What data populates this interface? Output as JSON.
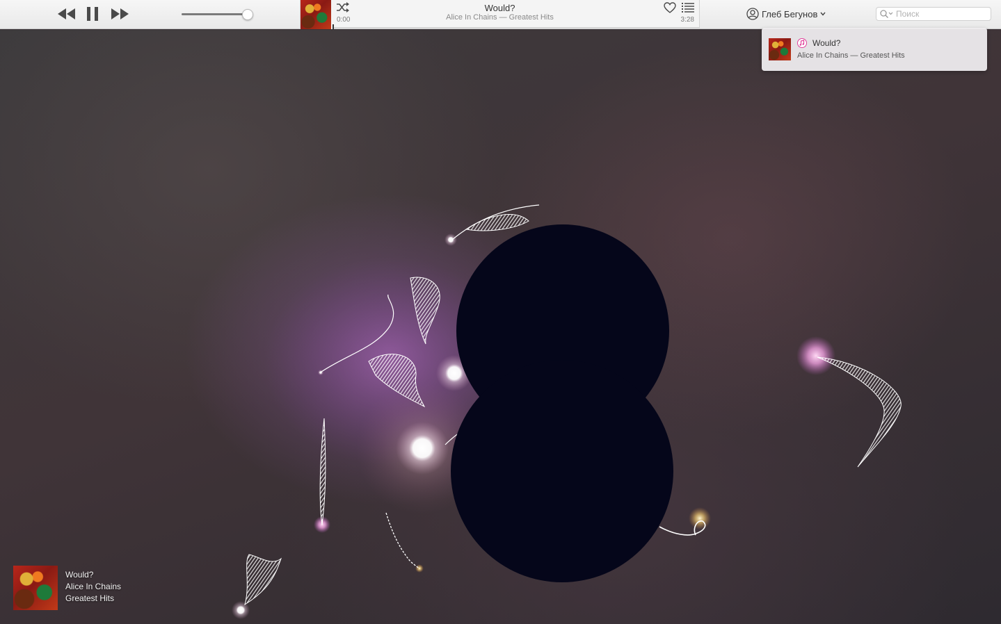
{
  "toolbar": {
    "volume_level": 0.92
  },
  "lcd": {
    "title": "Would?",
    "subtitle": "Alice In Chains — Greatest Hits",
    "time_elapsed": "0:00",
    "time_total": "3:28",
    "progress": 0
  },
  "account": {
    "name": "Глеб Бегунов"
  },
  "search": {
    "placeholder": "Поиск"
  },
  "notification": {
    "title": "Would?",
    "subtitle": "Alice In Chains — Greatest Hits"
  },
  "now_playing": {
    "title": "Would?",
    "artist": "Alice In Chains",
    "album": "Greatest Hits"
  },
  "icons": {
    "rewind": "rewind-icon",
    "pause": "pause-icon",
    "forward": "forward-icon",
    "shuffle": "shuffle-icon",
    "love": "heart-icon",
    "up_next": "list-icon",
    "account": "user-icon",
    "search": "search-icon",
    "app": "itunes-note-icon"
  },
  "colors": {
    "toolbar_bg": "#efefef",
    "visualizer_bg": "#3a3236",
    "dark_orb": "#05061a",
    "accent_itunes": "#e0409a"
  }
}
